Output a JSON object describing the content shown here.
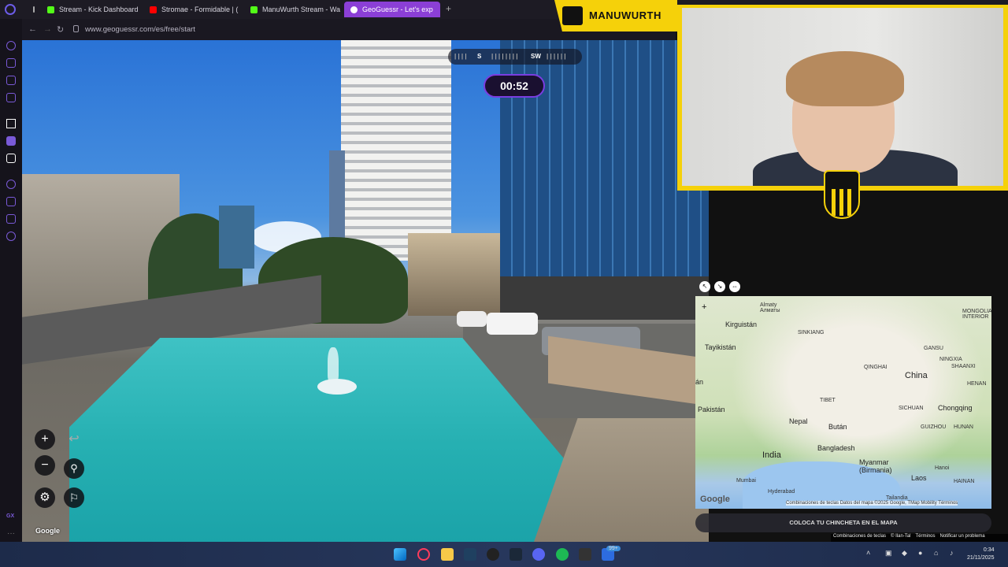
{
  "browser": {
    "tabs": [
      {
        "label": "Stream - Kick Dashboard",
        "favicon_color": "#53fc18",
        "active": false
      },
      {
        "label": "Stromae - Formidable | (",
        "favicon_color": "#ff0000",
        "active": false
      },
      {
        "label": "ManuWurth Stream - Wat",
        "favicon_color": "#53fc18",
        "active": false
      },
      {
        "label": "GeoGuessr - Let's exp",
        "favicon_color": "#ffffff",
        "active": true
      }
    ],
    "new_tab": "+",
    "url": "www.geoguessr.com/es/free/start",
    "back": "←",
    "forward": "→",
    "reload": "↻"
  },
  "sidebar": {
    "gx_label": "GX",
    "more": "···"
  },
  "game": {
    "compass": {
      "s": "S",
      "sw": "SW"
    },
    "timer": "00:52",
    "zoom_in": "+",
    "zoom_out": "−",
    "undo": "↩",
    "pin": "⚲",
    "settings": "⚙",
    "flag": "⚐",
    "street_google": "Google"
  },
  "webcam": {
    "streamer_name": "MANUWURTH"
  },
  "map": {
    "labels": {
      "almaty": "Almaty\nАлматы",
      "kirguistan": "Kirguistán",
      "tayikistan": "Tayikistán",
      "xinjiang": "SINKIANG",
      "qinghai": "QINGHAI",
      "gansu": "GANSU",
      "ningxia": "NINGXIA",
      "shaanxi": "SHAANXI",
      "mongolia": "MONGOLIA\nINTERIOR",
      "china": "China",
      "tibet": "TIBET",
      "henan": "HENAN",
      "sichuan": "SICHUAN",
      "chongqing": "Chongqing",
      "guizhou": "GUIZHOU",
      "hunan": "HUNAN",
      "pakistan": "Pakistán",
      "afg": "án",
      "nepal": "Nepal",
      "butan": "Bután",
      "india": "India",
      "bangladesh": "Bangladesh",
      "myanmar": "Myanmar\n(Birmania)",
      "laos": "Laos",
      "hanoi": "Hanoi",
      "mumbai": "Mumbai",
      "hyderabad": "Hyderabad",
      "tailandia": "Tailandia",
      "hainan": "HAINAN"
    },
    "zoom_in": "+",
    "google": "Google",
    "attribution": "Combinaciones de teclas   Datos del mapa ©2025 Google, TMap Mobility   Términos",
    "place_pin": "COLOCA TU CHINCHETA EN EL MAPA"
  },
  "footer": {
    "shortcuts": "Combinaciones de teclas",
    "copyright": "© Ilan-Tal",
    "terms": "Términos",
    "report": "Notificar un problema"
  },
  "taskbar": {
    "badge": "99+",
    "time": "0:34",
    "date": "21/11/2025"
  }
}
